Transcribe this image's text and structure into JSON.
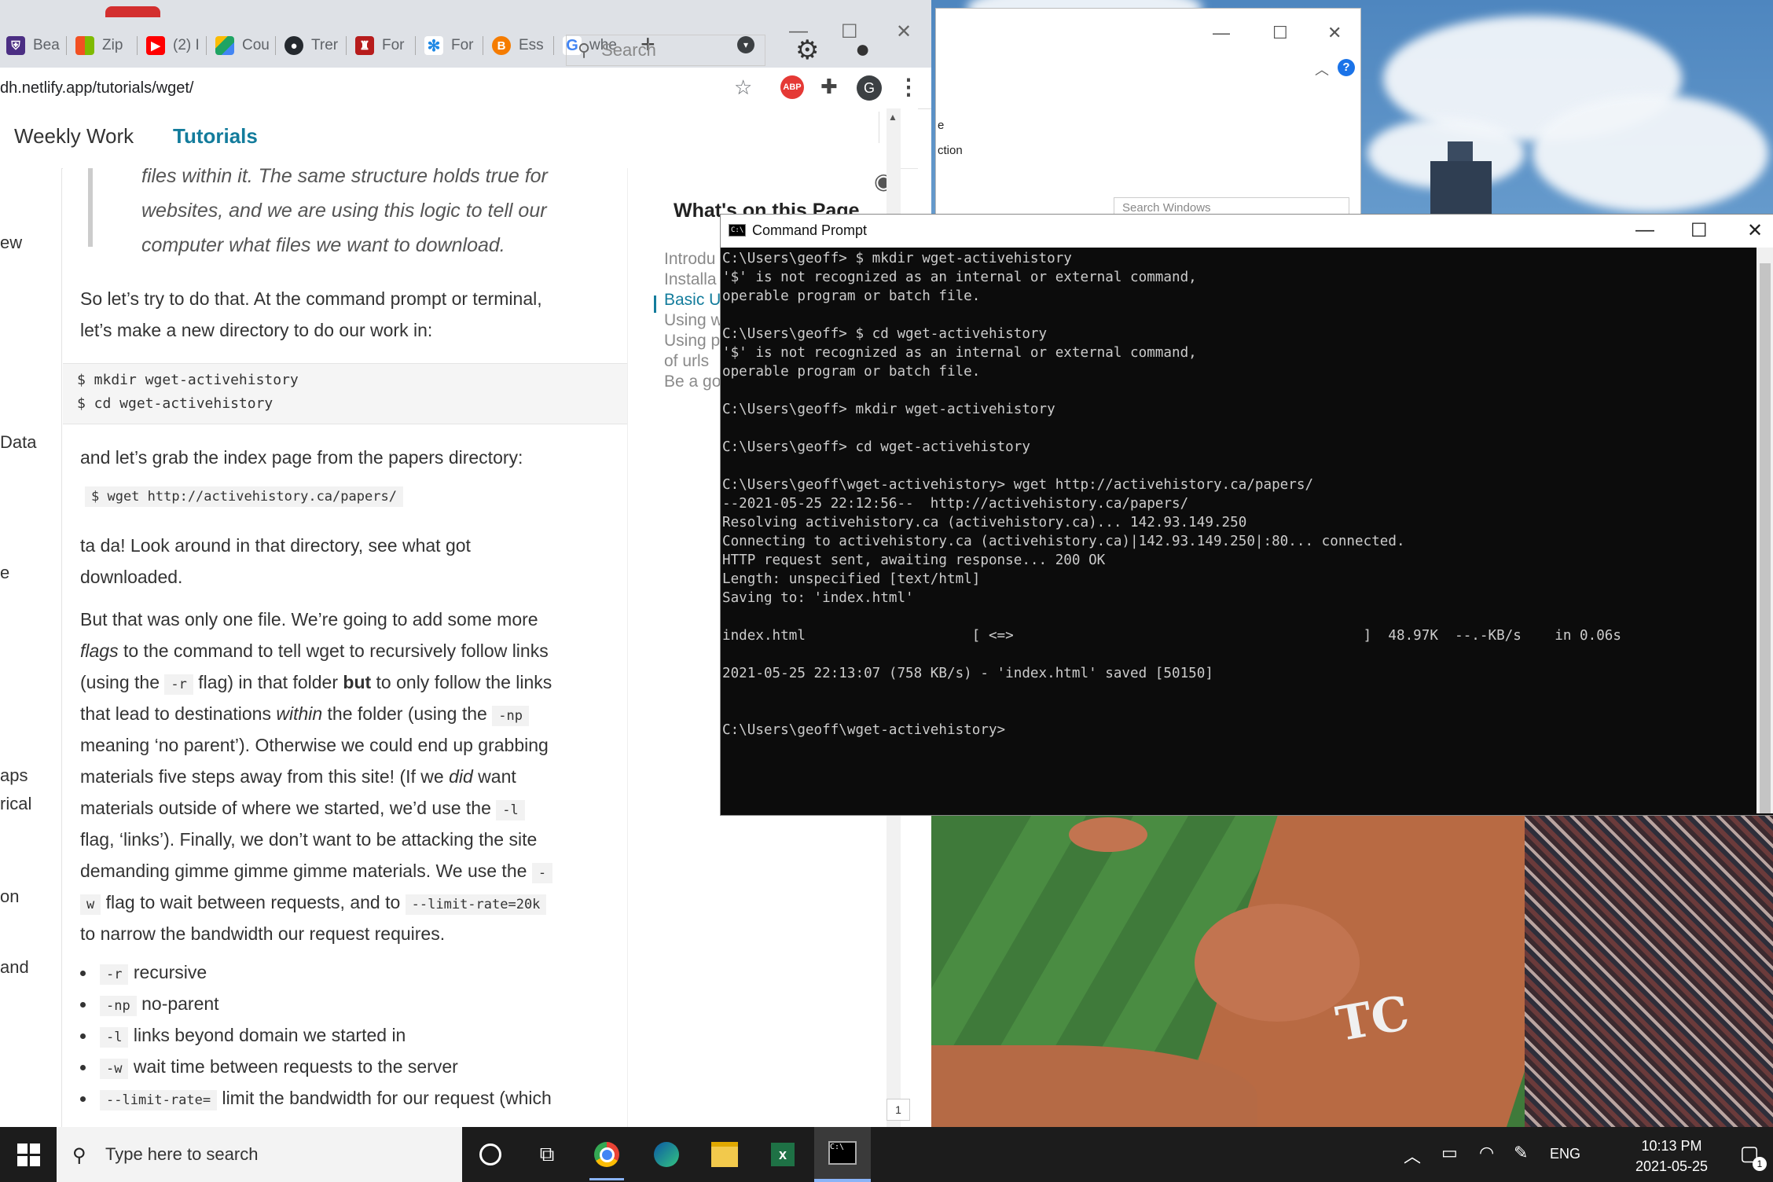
{
  "chrome": {
    "tabs": [
      {
        "label": "Bea",
        "icon": "shield-icon",
        "color": "#4b2e83"
      },
      {
        "label": "Zip",
        "icon": "microsoft-icon",
        "color": "#f25022"
      },
      {
        "label": "(2) I",
        "icon": "youtube-icon",
        "color": "#ff0000"
      },
      {
        "label": "Cou",
        "icon": "google-drive-icon",
        "color": "#1fa463"
      },
      {
        "label": "Trer",
        "icon": "github-icon",
        "color": "#24292e"
      },
      {
        "label": "For",
        "icon": "crest-icon",
        "color": "#b71c1c"
      },
      {
        "label": "For",
        "icon": "sparkle-icon",
        "color": "#1e88e5"
      },
      {
        "label": "Ess",
        "icon": "blogger-icon",
        "color": "#f57c00"
      },
      {
        "label": "whe",
        "icon": "google-icon",
        "color": "#4285f4"
      }
    ],
    "url": "dh.netlify.app/tutorials/wget/",
    "profile_initial": "G",
    "abp_label": "ABP"
  },
  "site": {
    "nav": {
      "weekly": "Weekly Work",
      "tutorials": "Tutorials"
    },
    "search_placeholder": "Search",
    "left_sidebar": [
      "ew",
      "Data",
      "e",
      "aps",
      "rical",
      "on",
      "and"
    ],
    "toc_title": "What's on this Page",
    "toc": [
      "Introdu",
      "Installa",
      "Basic U",
      "Using w",
      "Using p",
      "of urls",
      "Be a go"
    ],
    "page_badge": "1"
  },
  "article": {
    "quote_lines": [
      "files within it. The same structure holds true for",
      "websites, and we are using this logic to tell our",
      "computer what files we want to download."
    ],
    "p1": [
      "So let’s try to do that. At the command prompt or terminal,",
      "let’s make a new directory to do our work in:"
    ],
    "code1": [
      "$ mkdir wget-activehistory",
      "$ cd wget-activehistory"
    ],
    "p2": "and let’s grab the index page from the papers directory:",
    "code2": "$ wget http://activehistory.ca/papers/",
    "p3": [
      "ta da! Look around in that directory, see what got",
      "downloaded."
    ],
    "p4": {
      "l1": "But that was only one file. We’re going to add some more",
      "l2a": "flags",
      "l2b": " to the command to tell wget to recursively follow links",
      "l3a": "(using the ",
      "l3code": "-r",
      "l3b": " flag) in that folder ",
      "l3bold": "but",
      "l3c": " to only follow the links",
      "l4a": "that lead to destinations ",
      "l4em": "within",
      "l4b": " the folder (using the ",
      "l4code": "-np",
      "l5": "meaning ‘no parent’). Otherwise we could end up grabbing",
      "l6a": "materials five steps away from this site! (If we ",
      "l6em": "did",
      "l6b": " want",
      "l7a": "materials outside of where we started, we’d use the ",
      "l7code": "-l",
      "l8": "flag, ‘links’). Finally, we don’t want to be attacking the site",
      "l9a": "demanding gimme gimme gimme materials. We use the ",
      "l9code": "-",
      "l10code": "w",
      "l10a": " flag to wait between requests, and to ",
      "l10code2": "--limit-rate=20k",
      "l11": "to narrow the bandwidth our request requires."
    },
    "bullets": [
      {
        "code": "-r",
        "text": "recursive"
      },
      {
        "code": "-np",
        "text": "no-parent"
      },
      {
        "code": "-l",
        "text": "links beyond domain we started in"
      },
      {
        "code": "-w",
        "text": "wait time between requests to the server"
      },
      {
        "code": "--limit-rate=",
        "text": "limit the bandwidth for our request (which"
      }
    ]
  },
  "explorer": {
    "text1": "e",
    "text2": "ction",
    "search_placeholder": "Search Windows"
  },
  "cmd": {
    "title": "Command Prompt",
    "lines": [
      "C:\\Users\\geoff> $ mkdir wget-activehistory",
      "'$' is not recognized as an internal or external command,",
      "operable program or batch file.",
      "",
      "C:\\Users\\geoff> $ cd wget-activehistory",
      "'$' is not recognized as an internal or external command,",
      "operable program or batch file.",
      "",
      "C:\\Users\\geoff> mkdir wget-activehistory",
      "",
      "C:\\Users\\geoff> cd wget-activehistory",
      "",
      "C:\\Users\\geoff\\wget-activehistory> wget http://activehistory.ca/papers/",
      "--2021-05-25 22:12:56--  http://activehistory.ca/papers/",
      "Resolving activehistory.ca (activehistory.ca)... 142.93.149.250",
      "Connecting to activehistory.ca (activehistory.ca)|142.93.149.250|:80... connected.",
      "HTTP request sent, awaiting response... 200 OK",
      "Length: unspecified [text/html]",
      "Saving to: 'index.html'",
      "",
      "index.html                    [ <=>                                          ]  48.97K  --.-KB/s    in 0.06s",
      "",
      "2021-05-25 22:13:07 (758 KB/s) - 'index.html' saved [50150]",
      "",
      "",
      "C:\\Users\\geoff\\wget-activehistory>"
    ]
  },
  "taskbar": {
    "search_placeholder": "Type here to search",
    "language": "ENG",
    "time": "10:13 PM",
    "date": "2021-05-25",
    "notification_count": "1"
  }
}
